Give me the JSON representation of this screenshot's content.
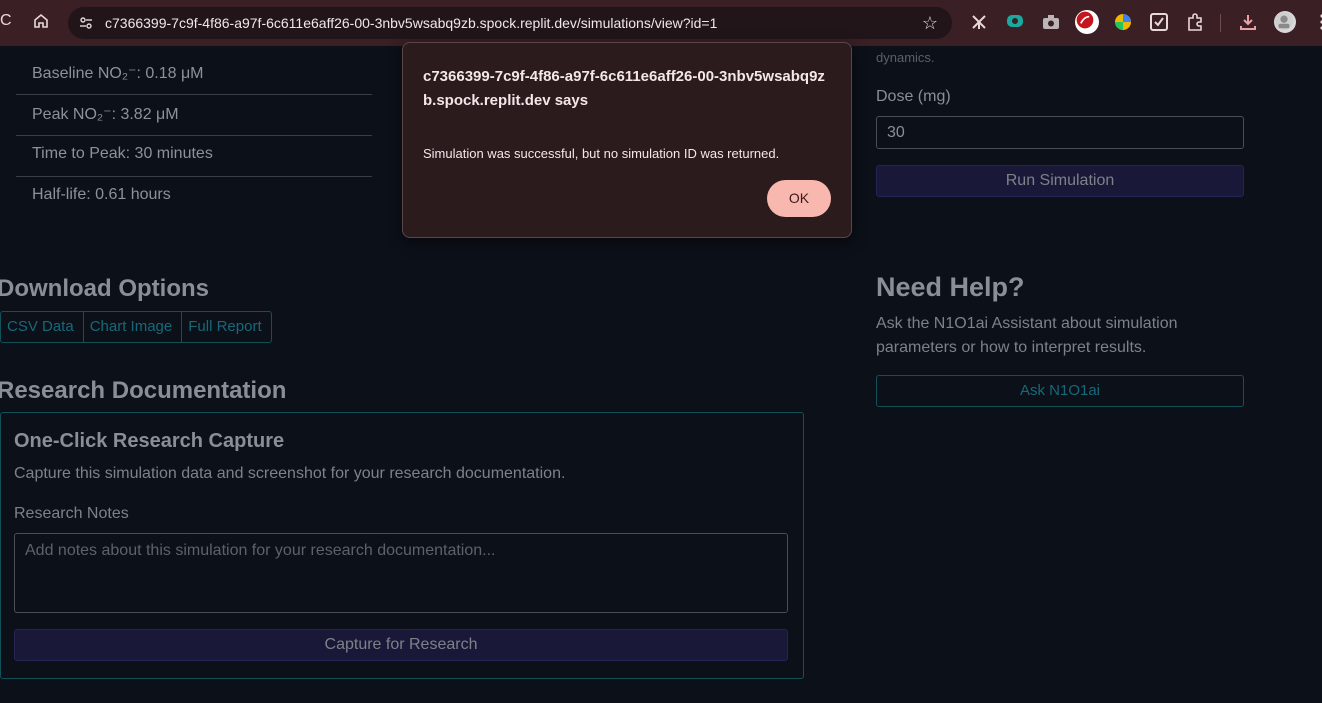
{
  "browser": {
    "url": "c7366399-7c9f-4f86-a97f-6c611e6aff26-00-3nbv5wsabq9zb.spock.replit.dev/simulations/view?id=1",
    "reload_glyph": "C",
    "star_glyph": "☆"
  },
  "stats": {
    "baseline": "Baseline NO₂⁻: 0.18 μM",
    "peak": "Peak NO₂⁻: 3.82 μM",
    "time_to_peak": "Time to Peak: 30 minutes",
    "half_life": "Half-life: 0.61 hours"
  },
  "download": {
    "heading": "Download Options",
    "buttons": [
      "CSV Data",
      "Chart Image",
      "Full Report"
    ]
  },
  "research": {
    "heading": "Research Documentation",
    "card_title": "One-Click Research Capture",
    "card_desc": "Capture this simulation data and screenshot for your research documentation.",
    "notes_label": "Research Notes",
    "notes_placeholder": "Add notes about this simulation for your research documentation...",
    "capture_label": "Capture for Research"
  },
  "right": {
    "dynamics_text": "dynamics.",
    "dose_label": "Dose (mg)",
    "dose_value": "30",
    "run_label": "Run Simulation",
    "help_heading": "Need Help?",
    "help_text": "Ask the N1O1ai Assistant about simulation parameters or how to interpret results.",
    "ask_label": "Ask N1O1ai"
  },
  "dialog": {
    "origin": "c7366399-7c9f-4f86-a97f-6c611e6aff26-00-3nbv5wsabq9zb.spock.replit.dev says",
    "message": "Simulation was successful, but no simulation ID was returned.",
    "ok_label": "OK"
  },
  "colors": {
    "page_bg": "#0c1018",
    "chrome_bg": "#3a1f24",
    "teal_accent": "#17697a",
    "dialog_ok": "#f8b7af"
  }
}
